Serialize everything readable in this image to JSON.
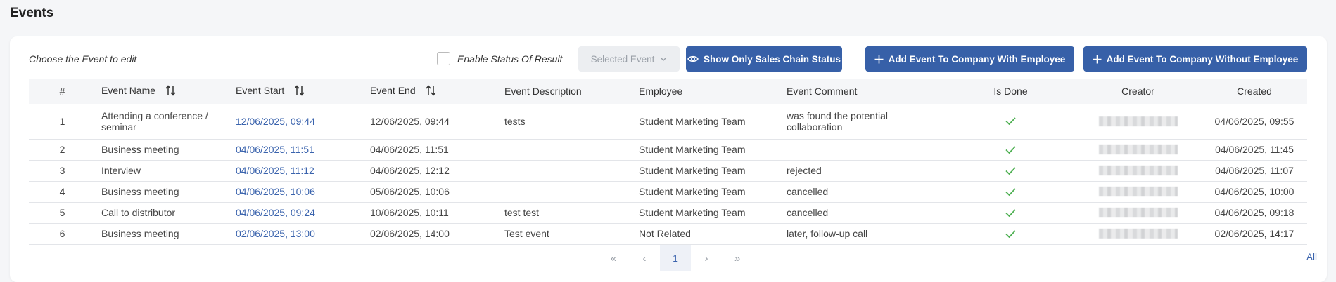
{
  "page": {
    "title": "Events"
  },
  "toolbar": {
    "choose_label": "Choose the Event to edit",
    "enable_status_label": "Enable Status Of Result",
    "selected_event_placeholder": "Selected Event",
    "show_sales_chain_label": "Show Only Sales Chain Status",
    "add_with_employee_label": "Add Event To Company With Employee",
    "add_without_employee_label": "Add Event To Company Without Employee"
  },
  "table": {
    "headers": [
      "#",
      "Event Name",
      "Event Start",
      "Event End",
      "Event Description",
      "Employee",
      "Event Comment",
      "Is Done",
      "Creator",
      "Created"
    ],
    "rows": [
      {
        "num": "1",
        "name": "Attending a conference / seminar",
        "start": "12/06/2025, 09:44",
        "end": "12/06/2025, 09:44",
        "description": "tests",
        "employee": "Student Marketing Team",
        "comment": "was found the potential collaboration",
        "done": true,
        "created": "04/06/2025, 09:55"
      },
      {
        "num": "2",
        "name": "Business meeting",
        "start": "04/06/2025, 11:51",
        "end": "04/06/2025, 11:51",
        "description": "",
        "employee": "Student Marketing Team",
        "comment": "",
        "done": true,
        "created": "04/06/2025, 11:45"
      },
      {
        "num": "3",
        "name": "Interview",
        "start": "04/06/2025, 11:12",
        "end": "04/06/2025, 12:12",
        "description": "",
        "employee": "Student Marketing Team",
        "comment": "rejected",
        "done": true,
        "created": "04/06/2025, 11:07"
      },
      {
        "num": "4",
        "name": "Business meeting",
        "start": "04/06/2025, 10:06",
        "end": "05/06/2025, 10:06",
        "description": "",
        "employee": "Student Marketing Team",
        "comment": "cancelled",
        "done": true,
        "created": "04/06/2025, 10:00"
      },
      {
        "num": "5",
        "name": "Call to distributor",
        "start": "04/06/2025, 09:24",
        "end": "10/06/2025, 10:11",
        "description": "test test",
        "employee": "Student Marketing Team",
        "comment": "cancelled",
        "done": true,
        "created": "04/06/2025, 09:18"
      },
      {
        "num": "6",
        "name": "Business meeting",
        "start": "02/06/2025, 13:00",
        "end": "02/06/2025, 14:00",
        "description": "Test event",
        "employee": "Not Related",
        "comment": "later, follow-up call",
        "done": true,
        "created": "02/06/2025, 14:17"
      }
    ]
  },
  "pagination": {
    "first": "«",
    "prev": "‹",
    "current": "1",
    "next": "›",
    "last": "»",
    "all_label": "All"
  },
  "colors": {
    "accent": "#3760a8",
    "link": "#3a63ad",
    "done_check": "#4caf50"
  }
}
